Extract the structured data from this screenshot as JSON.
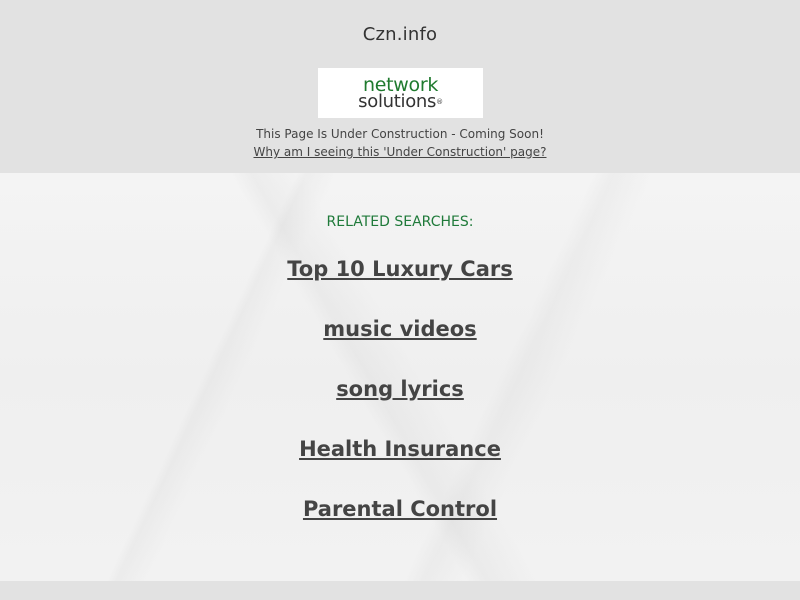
{
  "header": {
    "site_name": "Czn.info",
    "logo": {
      "line1": "network",
      "line2": "solutions",
      "registered_mark": "®"
    },
    "status_text": "This Page Is Under Construction - Coming Soon!",
    "why_link": "Why am I seeing this 'Under Construction' page?"
  },
  "main": {
    "related_heading": "RELATED SEARCHES:",
    "searches": [
      "Top 10 Luxury Cars",
      "music videos",
      "song lyrics",
      "Health Insurance",
      "Parental Control"
    ]
  },
  "colors": {
    "header_bg": "#e2e2e2",
    "accent_green": "#1f7a3a",
    "link_text": "#444444"
  }
}
